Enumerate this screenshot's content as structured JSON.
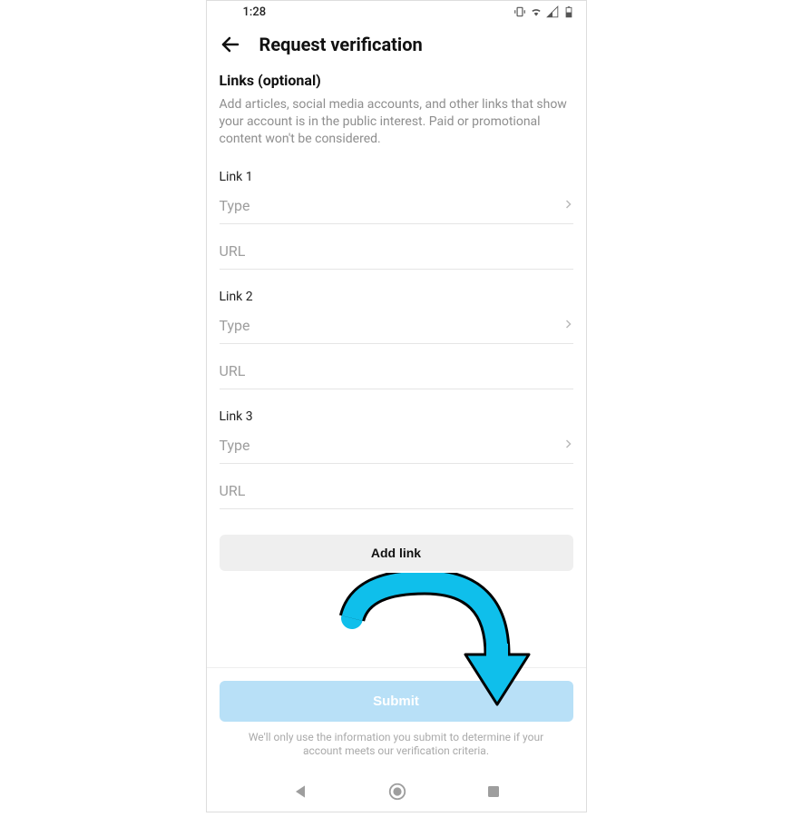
{
  "status_bar": {
    "time": "1:28"
  },
  "header": {
    "title": "Request verification"
  },
  "section": {
    "title": "Links (optional)",
    "description": "Add articles, social media accounts, and other links that show your account is in the public interest. Paid or promotional content won't be considered."
  },
  "links": [
    {
      "label": "Link 1",
      "type_placeholder": "Type",
      "url_placeholder": "URL"
    },
    {
      "label": "Link 2",
      "type_placeholder": "Type",
      "url_placeholder": "URL"
    },
    {
      "label": "Link 3",
      "type_placeholder": "Type",
      "url_placeholder": "URL"
    }
  ],
  "buttons": {
    "add_link": "Add link",
    "submit": "Submit"
  },
  "footer_note": "We'll only use the information you submit to determine if your account meets our verification criteria.",
  "colors": {
    "accent_arrow": "#0FBFEB",
    "submit_bg": "#b8e0f7"
  }
}
